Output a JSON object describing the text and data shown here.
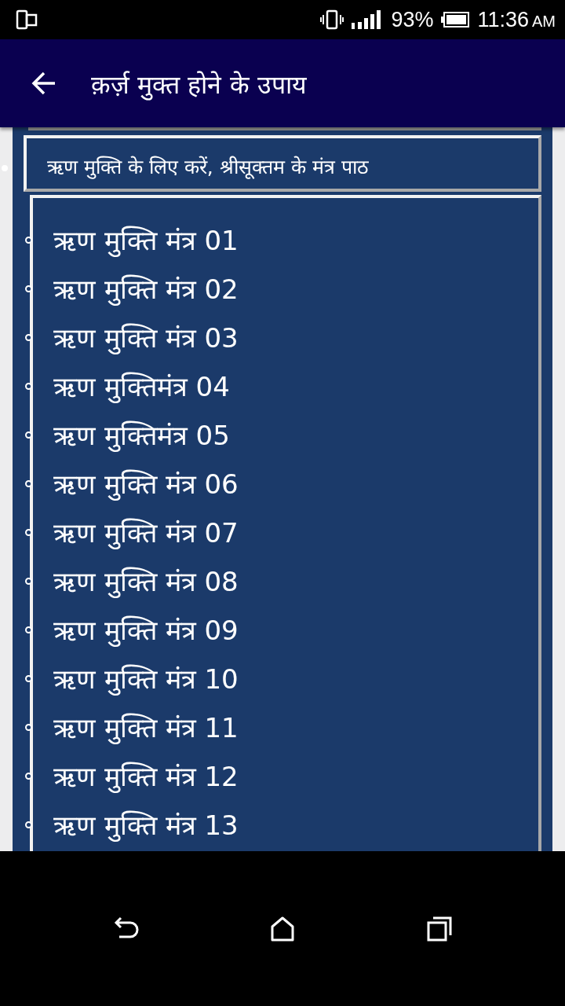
{
  "status_bar": {
    "battery": "93%",
    "time": "11:36",
    "ampm": "AM"
  },
  "app_bar": {
    "title": "क़र्ज़ मुक्त होने के उपाय"
  },
  "section": {
    "heading": "ऋण मुक्ति के लिए करें, श्रीसूक्तम के मंत्र पाठ"
  },
  "items": [
    {
      "label": "ऋण मुक्ति मंत्र 01"
    },
    {
      "label": "ऋण मुक्ति मंत्र 02"
    },
    {
      "label": "ऋण मुक्ति मंत्र 03"
    },
    {
      "label": "ऋण मुक्तिमंत्र 04"
    },
    {
      "label": "ऋण मुक्तिमंत्र 05"
    },
    {
      "label": "ऋण मुक्ति मंत्र 06"
    },
    {
      "label": "ऋण मुक्ति मंत्र 07"
    },
    {
      "label": "ऋण मुक्ति मंत्र 08"
    },
    {
      "label": "ऋण मुक्ति मंत्र 09"
    },
    {
      "label": "ऋण मुक्ति मंत्र 10"
    },
    {
      "label": "ऋण मुक्ति मंत्र 11"
    },
    {
      "label": "ऋण मुक्ति मंत्र 12"
    },
    {
      "label": "ऋण मुक्ति मंत्र 13"
    }
  ]
}
